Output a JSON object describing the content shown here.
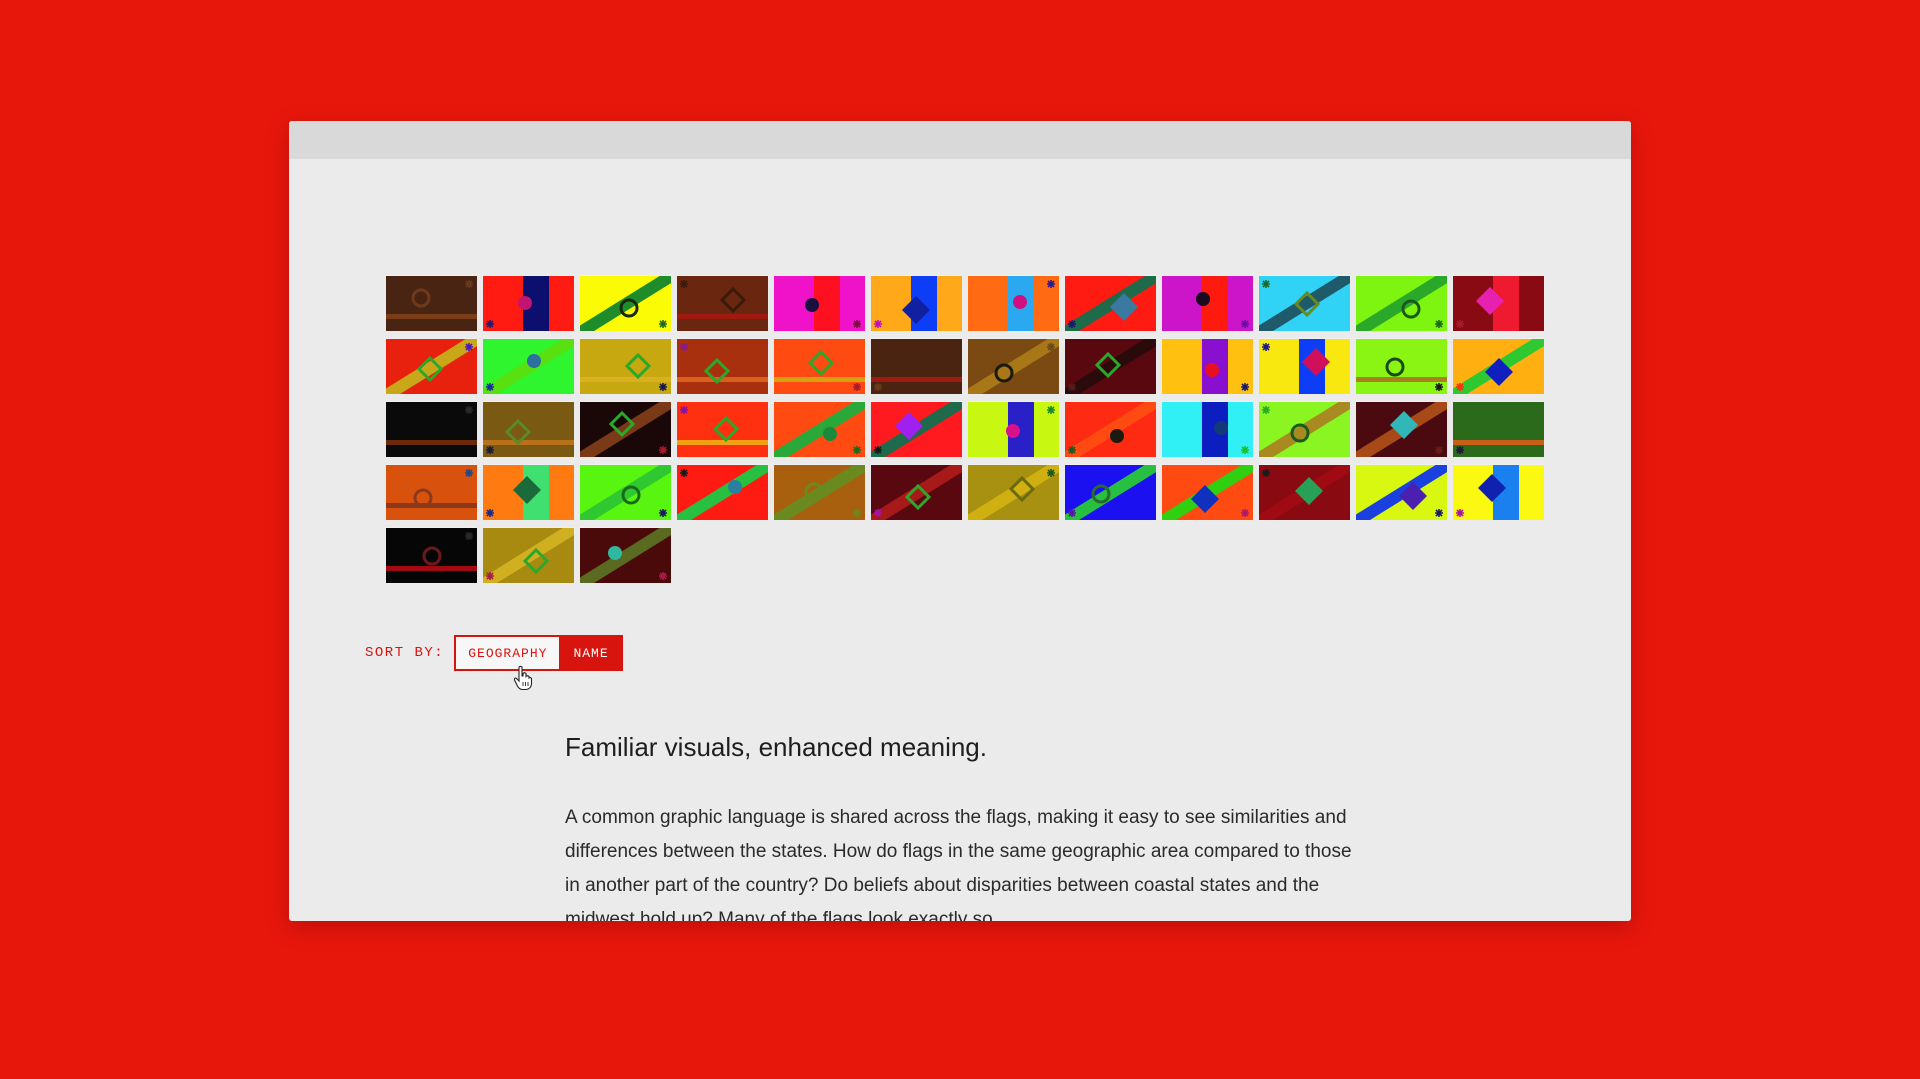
{
  "flags": [
    {
      "bg": "#4a2412",
      "stripe": "#7a3d18",
      "shape": "ring",
      "shapeColor": "#6e3a1c",
      "corner": "#6b3a1b"
    },
    {
      "bg": "#ff1a12",
      "band": "#0d0f6e",
      "band2": "#ff1a12",
      "shape": "dot",
      "shapeColor": "#c21470",
      "corner": "#2a1a6a"
    },
    {
      "bg": "#fbfb05",
      "diag": "#1e8c2a",
      "shape": "ring",
      "shapeColor": "#1a2a10",
      "corner": "#1e6a1e"
    },
    {
      "bg": "#6a260e",
      "stripe": "#a01a10",
      "shape": "diamond-outline",
      "shapeColor": "#3a1a0a",
      "corner": "#3a1a0a"
    },
    {
      "bg": "#f012c8",
      "band": "#ff1020",
      "shape": "dot",
      "shapeColor": "#1a1040",
      "corner": "#7a1040"
    },
    {
      "bg": "#ffa81a",
      "band": "#0d3ef5",
      "shape": "diamond",
      "shapeColor": "#1020a0",
      "corner": "#c010c0"
    },
    {
      "bg": "#ff6a12",
      "band": "#2aa8f0",
      "shape": "dot",
      "shapeColor": "#d01080",
      "corner": "#2a1a8a"
    },
    {
      "bg": "#ff1a12",
      "diag": "#1e6a4a",
      "shape": "diamond",
      "shapeColor": "#3a7aa0",
      "corner": "#1a1a6a"
    },
    {
      "bg": "#cc14c8",
      "band": "#ff1a10",
      "shape": "dot",
      "shapeColor": "#1a0a20",
      "corner": "#6a10aa"
    },
    {
      "bg": "#30d2f5",
      "diag": "#1e5a6a",
      "shape": "diamond-outline",
      "shapeColor": "#6a8a20",
      "corner": "#1a6a2a"
    },
    {
      "bg": "#7ef510",
      "diag": "#2aa82a",
      "shape": "ring",
      "shapeColor": "#1a5a1a",
      "corner": "#1a6a1a"
    },
    {
      "bg": "#8a0a14",
      "band": "#f01a30",
      "shape": "diamond",
      "shapeColor": "#e820b0",
      "corner": "#aa1a2a"
    },
    {
      "bg": "#e8200e",
      "diag": "#c8a818",
      "shape": "diamond-outline",
      "shapeColor": "#2aa82a",
      "corner": "#4a1ac0"
    },
    {
      "bg": "#2ef52e",
      "diag": "#58e010",
      "shape": "dot",
      "shapeColor": "#2a70a0",
      "corner": "#1a2aa0"
    },
    {
      "bg": "#c8a810",
      "stripe": "#d8b020",
      "shape": "diamond-outline",
      "shapeColor": "#2aa82a",
      "corner": "#1a1a4a"
    },
    {
      "bg": "#a8300e",
      "stripe": "#d8601a",
      "shape": "diamond-outline",
      "shapeColor": "#2aa82a",
      "corner": "#8a1a8a"
    },
    {
      "bg": "#ff4a12",
      "stripe": "#d8a010",
      "shape": "diamond-outline",
      "shapeColor": "#2aa82a",
      "corner": "#aa1a2a"
    },
    {
      "bg": "#4a2410",
      "stripe": "#a01a10",
      "shape": "none",
      "shapeColor": "#000000",
      "corner": "#6a3a1a"
    },
    {
      "bg": "#7a4a12",
      "diag": "#a87818",
      "shape": "ring",
      "shapeColor": "#1a1a10",
      "corner": "#6a4a1a"
    },
    {
      "bg": "#5a0810",
      "diag": "#2a0a0a",
      "shape": "diamond-outline",
      "shapeColor": "#2aa82a",
      "corner": "#5a1a1a"
    },
    {
      "bg": "#ffc010",
      "band": "#8a10d0",
      "shape": "dot",
      "shapeColor": "#e81020",
      "corner": "#1a1a6a"
    },
    {
      "bg": "#f8e810",
      "band": "#0d3ef5",
      "shape": "diamond",
      "shapeColor": "#d0105a",
      "corner": "#1a1a8a"
    },
    {
      "bg": "#8af512",
      "stripe": "#a88020",
      "shape": "ring",
      "shapeColor": "#1a4a1a",
      "corner": "#1a1a1a"
    },
    {
      "bg": "#ffb010",
      "diag": "#30c830",
      "shape": "diamond",
      "shapeColor": "#1020c0",
      "corner": "#ff3010"
    },
    {
      "bg": "#0a0a0a",
      "stripe": "#6a2a0a",
      "shape": "none",
      "shapeColor": "#000000",
      "corner": "#2a2a2a"
    },
    {
      "bg": "#7a5a12",
      "stripe": "#b8701a",
      "shape": "diamond-outline",
      "shapeColor": "#5a8a2a",
      "corner": "#1a1a3a"
    },
    {
      "bg": "#1a0808",
      "diag": "#7a3a18",
      "shape": "diamond-outline",
      "shapeColor": "#2aa82a",
      "corner": "#aa1a2a"
    },
    {
      "bg": "#ff3010",
      "stripe": "#f0a010",
      "shape": "diamond-outline",
      "shapeColor": "#2aa82a",
      "corner": "#8a10aa"
    },
    {
      "bg": "#ff4a12",
      "diag": "#2aa83a",
      "shape": "dot",
      "shapeColor": "#1a8a3a",
      "corner": "#1a6a1a"
    },
    {
      "bg": "#ff1a20",
      "diag": "#1e6a4a",
      "shape": "diamond",
      "shapeColor": "#a020f0",
      "corner": "#1a1a1a"
    },
    {
      "bg": "#c8f812",
      "band": "#2a20c8",
      "shape": "dot",
      "shapeColor": "#d8108a",
      "corner": "#1a8a2a"
    },
    {
      "bg": "#ff2a12",
      "diag": "#ff4a12",
      "shape": "dot",
      "shapeColor": "#1a1a10",
      "corner": "#1a5a1a"
    },
    {
      "bg": "#30f0f5",
      "band": "#0d1ec0",
      "shape": "dot",
      "shapeColor": "#103a7a",
      "corner": "#1ac030"
    },
    {
      "bg": "#8af520",
      "diag": "#a88a20",
      "shape": "ring",
      "shapeColor": "#1a5a1a",
      "corner": "#2aa82a"
    },
    {
      "bg": "#4a0a10",
      "diag": "#a84a18",
      "shape": "diamond",
      "shapeColor": "#30b8b8",
      "corner": "#6a1a1a"
    },
    {
      "bg": "#2a6a1a",
      "stripe": "#c8601a",
      "shape": "ring",
      "shapeColor": "#2a6a1a",
      "corner": "#1a1a3a"
    },
    {
      "bg": "#d8520e",
      "stripe": "#8a3a1a",
      "shape": "ring",
      "shapeColor": "#8a3a1a",
      "corner": "#1a4a8a"
    },
    {
      "bg": "#ff7a10",
      "band": "#40e070",
      "shape": "diamond",
      "shapeColor": "#1a6a3a",
      "corner": "#1a2a8a"
    },
    {
      "bg": "#58f510",
      "diag": "#30c830",
      "shape": "ring",
      "shapeColor": "#1a6a1a",
      "corner": "#1a1a5a"
    },
    {
      "bg": "#ff1a12",
      "diag": "#28c040",
      "shape": "dot",
      "shapeColor": "#2a80a0",
      "corner": "#1a1a1a"
    },
    {
      "bg": "#a8600e",
      "diag": "#6a8a20",
      "shape": "ring",
      "shapeColor": "#6a8a20",
      "corner": "#6a8a20"
    },
    {
      "bg": "#5a0810",
      "diag": "#a81a1a",
      "shape": "diamond-outline",
      "shapeColor": "#2aa82a",
      "corner": "#aa10aa"
    },
    {
      "bg": "#a89010",
      "diag": "#d0b010",
      "shape": "diamond-outline",
      "shapeColor": "#6a6a10",
      "corner": "#1a5a1a"
    },
    {
      "bg": "#1a10f0",
      "diag": "#28c040",
      "shape": "ring",
      "shapeColor": "#2a6a2a",
      "corner": "#5a10aa"
    },
    {
      "bg": "#ff4a12",
      "diag": "#30d010",
      "shape": "diamond",
      "shapeColor": "#1030c0",
      "corner": "#aa1a6a"
    },
    {
      "bg": "#8a0a12",
      "diag": "#a00a12",
      "shape": "diamond",
      "shapeColor": "#28a058",
      "corner": "#1a1a1a"
    },
    {
      "bg": "#d8f812",
      "diag": "#1a40e0",
      "shape": "diamond",
      "shapeColor": "#4a20b0",
      "corner": "#1a1a6a"
    },
    {
      "bg": "#fbf812",
      "band": "#1a80f0",
      "shape": "diamond",
      "shapeColor": "#1020b0",
      "corner": "#aa10aa"
    },
    {
      "bg": "#060606",
      "stripe": "#a00a10",
      "shape": "ring",
      "shapeColor": "#6a1a1a",
      "corner": "#2a2a2a"
    },
    {
      "bg": "#a88a10",
      "diag": "#d0b020",
      "shape": "diamond-outline",
      "shapeColor": "#2aa82a",
      "corner": "#aa1a4a"
    },
    {
      "bg": "#4a0a0a",
      "diag": "#5a6a20",
      "shape": "dot",
      "shapeColor": "#30b8a0",
      "corner": "#aa1a4a"
    }
  ],
  "sort": {
    "label": "SORT BY:",
    "geography": "GEOGRAPHY",
    "name": "NAME"
  },
  "content": {
    "heading": "Familiar visuals, enhanced meaning.",
    "paragraph": "A common graphic language is shared across the flags, making it easy to see similarities and differences between the states. How do flags in the same geographic area compared to those in another part of the country? Do beliefs about disparities between coastal states and the midwest hold up? Many of the flags look exactly so"
  }
}
